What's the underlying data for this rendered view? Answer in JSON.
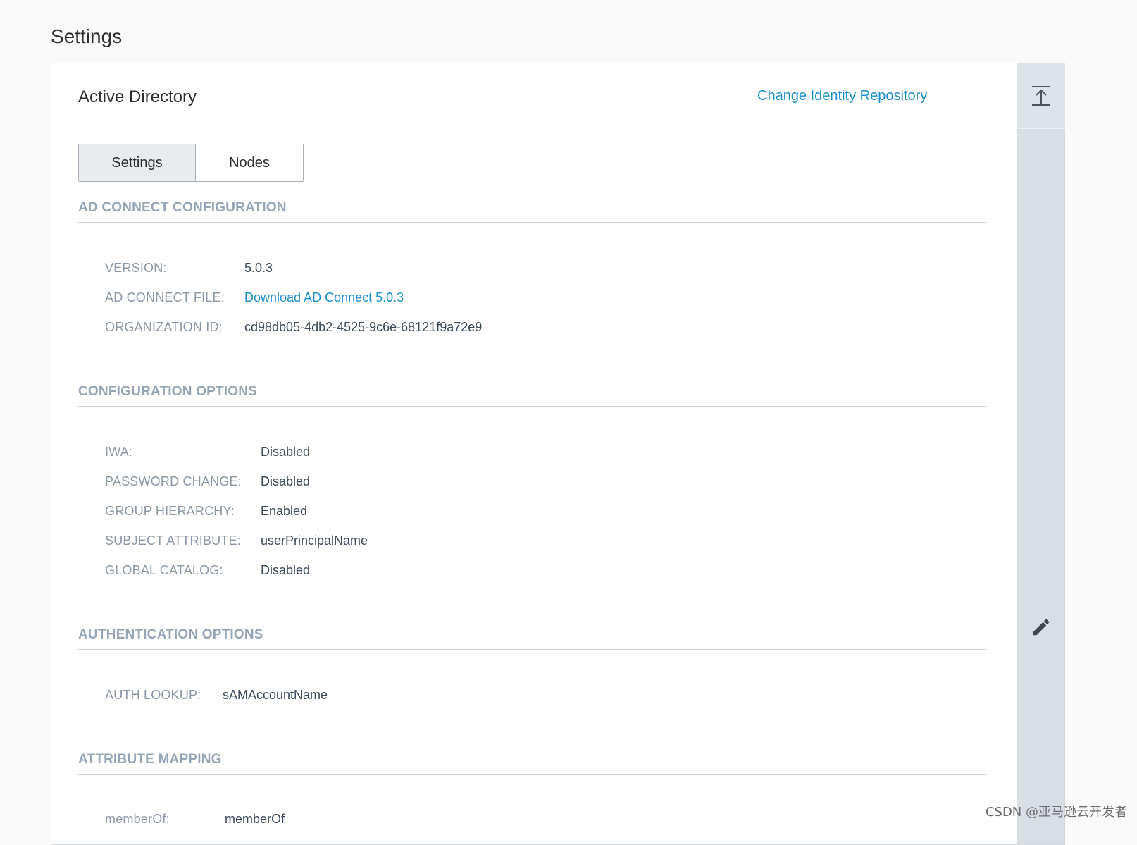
{
  "page": {
    "title": "Settings"
  },
  "card": {
    "title": "Active Directory",
    "change_link": "Change Identity Repository",
    "tabs": [
      {
        "label": "Settings",
        "active": true
      },
      {
        "label": "Nodes",
        "active": false
      }
    ]
  },
  "sections": {
    "ad_connect": {
      "heading": "AD CONNECT CONFIGURATION",
      "version_label": "VERSION:",
      "version_value": "5.0.3",
      "file_label": "AD CONNECT FILE:",
      "file_value": "Download AD Connect 5.0.3",
      "org_label": "ORGANIZATION ID:",
      "org_value": "cd98db05-4db2-4525-9c6e-68121f9a72e9"
    },
    "config_options": {
      "heading": "CONFIGURATION OPTIONS",
      "iwa_label": "IWA:",
      "iwa_value": "Disabled",
      "pwd_label": "PASSWORD CHANGE:",
      "pwd_value": "Disabled",
      "group_label": "GROUP HIERARCHY:",
      "group_value": "Enabled",
      "subject_label": "SUBJECT ATTRIBUTE:",
      "subject_value": "userPrincipalName",
      "catalog_label": "GLOBAL CATALOG:",
      "catalog_value": "Disabled"
    },
    "auth_options": {
      "heading": "AUTHENTICATION OPTIONS",
      "lookup_label": "AUTH LOOKUP:",
      "lookup_value": "sAMAccountName"
    },
    "attribute_mapping": {
      "heading": "ATTRIBUTE MAPPING",
      "memberof_label": "memberOf:",
      "memberof_value": "memberOf"
    }
  },
  "rail": {
    "top_icon": "collapse-to-top-icon",
    "edit_icon": "pencil-icon"
  },
  "watermark": "CSDN @亚马逊云开发者",
  "colors": {
    "link": "#1a8fcf",
    "section_heading": "#95a5b8",
    "rail": "#d8dee6"
  }
}
